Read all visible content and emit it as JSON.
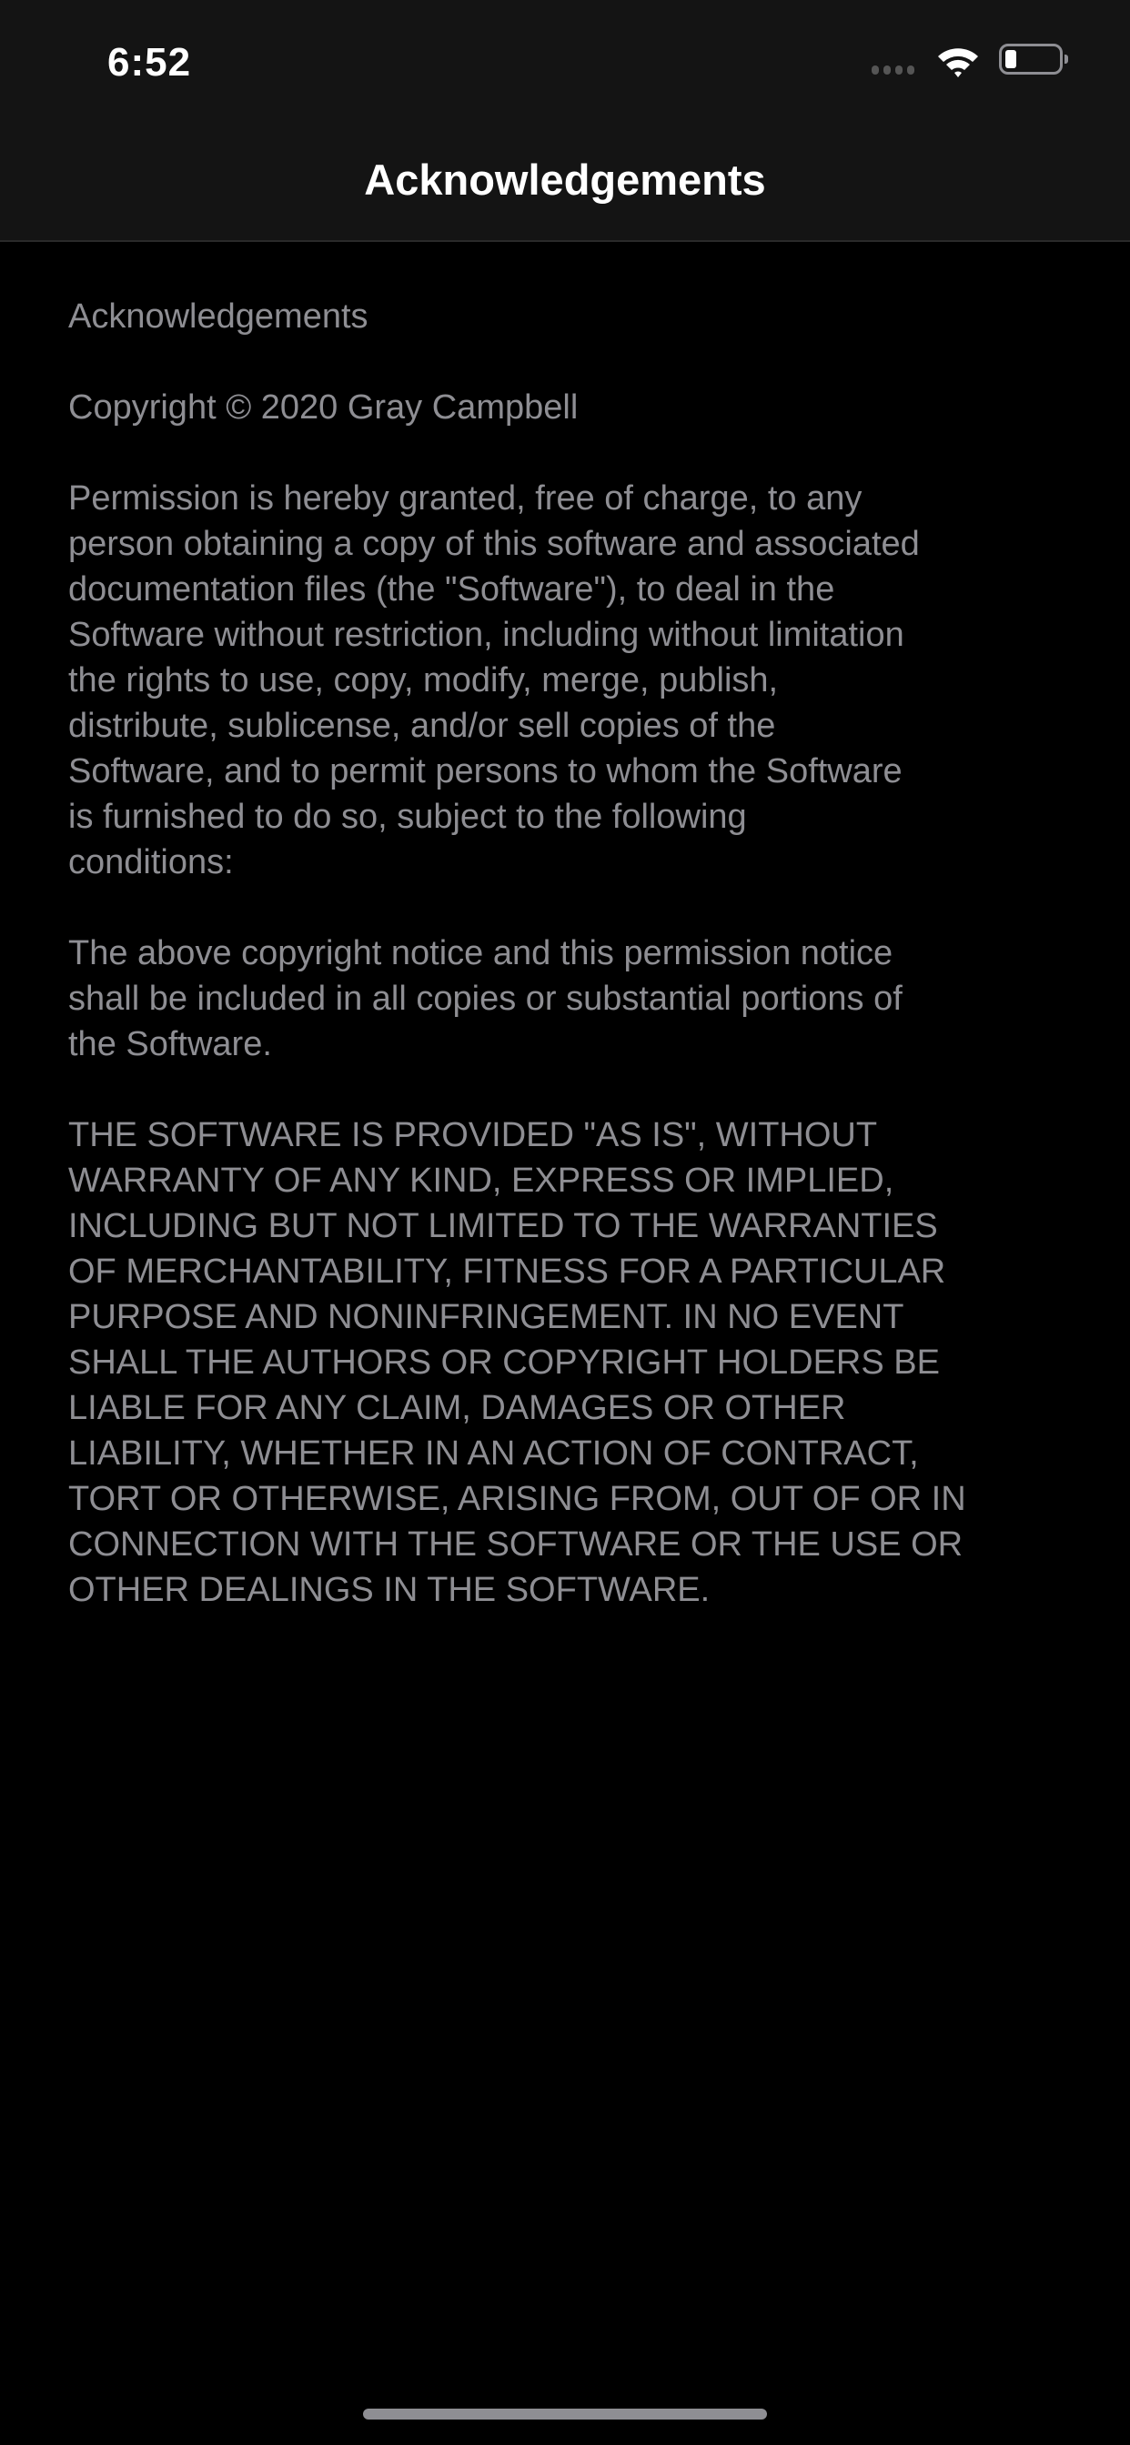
{
  "status_bar": {
    "time": "6:52"
  },
  "nav": {
    "title": "Acknowledgements"
  },
  "content": {
    "lines": [
      "Acknowledgements",
      "",
      "Copyright © 2020 Gray Campbell",
      "",
      "Permission is hereby granted, free of charge, to any",
      "person obtaining a copy of this software and associated",
      "documentation files (the \"Software\"), to deal in the",
      "Software without restriction, including without limitation",
      "the rights to use, copy, modify, merge, publish,",
      "distribute, sublicense, and/or sell copies of the",
      "Software, and to permit persons to whom the Software",
      "is furnished to do so, subject to the following",
      "conditions:",
      "",
      "The above copyright notice and this permission notice",
      "shall be included in all copies or substantial portions of",
      "the Software.",
      "",
      "THE SOFTWARE IS PROVIDED \"AS IS\", WITHOUT",
      "WARRANTY OF ANY KIND, EXPRESS OR IMPLIED,",
      "INCLUDING BUT NOT LIMITED TO THE WARRANTIES",
      "OF MERCHANTABILITY, FITNESS FOR A PARTICULAR",
      "PURPOSE AND NONINFRINGEMENT. IN NO EVENT",
      "SHALL THE AUTHORS OR COPYRIGHT HOLDERS BE",
      "LIABLE FOR ANY CLAIM, DAMAGES OR OTHER",
      "LIABILITY, WHETHER IN AN ACTION OF CONTRACT,",
      "TORT OR OTHERWISE, ARISING FROM, OUT OF OR IN",
      "CONNECTION WITH THE SOFTWARE OR THE USE OR",
      "OTHER DEALINGS IN THE SOFTWARE."
    ]
  },
  "colors": {
    "text": "#8e8e93",
    "header_bg": "#141414",
    "background": "#000000"
  },
  "icons": {
    "signal": "signal-icon",
    "wifi": "wifi-icon",
    "battery": "battery-icon"
  }
}
